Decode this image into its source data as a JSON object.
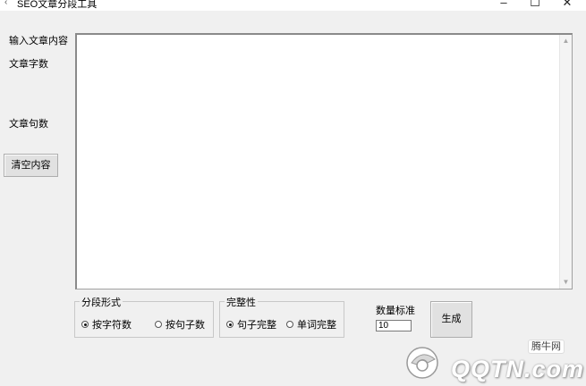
{
  "window": {
    "title": "SEO文章分段工具",
    "minimize_glyph": "–",
    "maximize_glyph": "☐",
    "close_glyph": "✕"
  },
  "labels": {
    "input_content": "输入文章内容",
    "word_count": "文章字数",
    "sentence_count": "文章句数"
  },
  "buttons": {
    "clear": "清空内容",
    "generate": "生成"
  },
  "editor": {
    "value": "",
    "scroll_up": "▲",
    "scroll_down": "▼"
  },
  "segment_mode": {
    "title": "分段形式",
    "options": [
      {
        "label": "按字符数",
        "checked": true
      },
      {
        "label": "按句子数",
        "checked": false
      }
    ]
  },
  "completeness": {
    "title": "完整性",
    "options": [
      {
        "label": "句子完整",
        "checked": true
      },
      {
        "label": "单词完整",
        "checked": false
      }
    ]
  },
  "quantity": {
    "label": "数量标准",
    "value": "10"
  },
  "watermark": {
    "badge": "腾牛网",
    "text": "QQTN.com"
  },
  "colors": {
    "window_bg": "#f0f0f0",
    "editor_bg": "#ffffff",
    "button_bg": "#e1e1e1"
  }
}
